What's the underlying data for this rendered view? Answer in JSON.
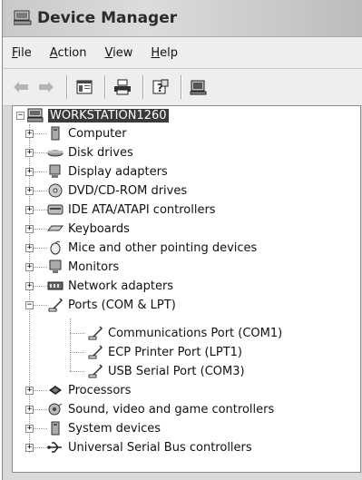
{
  "window": {
    "title": "Device Manager"
  },
  "menu": [
    {
      "label": "File",
      "underline": "F",
      "rest": "ile"
    },
    {
      "label": "Action",
      "underline": "A",
      "rest": "ction"
    },
    {
      "label": "View",
      "underline": "V",
      "rest": "iew"
    },
    {
      "label": "Help",
      "underline": "H",
      "rest": "elp"
    }
  ],
  "toolbar": {
    "buttons": [
      "back-arrow-icon",
      "forward-arrow-icon",
      "properties-pane-icon",
      "print-icon",
      "help-icon",
      "scan-hardware-icon"
    ]
  },
  "tree": {
    "root": {
      "label": "WORKSTATION1260",
      "expanded": true,
      "selected": true
    },
    "categories": [
      {
        "label": "Computer",
        "icon": "computer-icon",
        "expanded": false
      },
      {
        "label": "Disk drives",
        "icon": "disk-drive-icon",
        "expanded": false
      },
      {
        "label": "Display adapters",
        "icon": "display-adapter-icon",
        "expanded": false
      },
      {
        "label": "DVD/CD-ROM drives",
        "icon": "cdrom-icon",
        "expanded": false
      },
      {
        "label": "IDE ATA/ATAPI controllers",
        "icon": "ide-controller-icon",
        "expanded": false
      },
      {
        "label": "Keyboards",
        "icon": "keyboard-icon",
        "expanded": false
      },
      {
        "label": "Mice and other pointing devices",
        "icon": "mouse-icon",
        "expanded": false
      },
      {
        "label": "Monitors",
        "icon": "monitor-icon",
        "expanded": false
      },
      {
        "label": "Network adapters",
        "icon": "network-adapter-icon",
        "expanded": false
      },
      {
        "label": "Ports (COM & LPT)",
        "icon": "port-icon",
        "expanded": true,
        "children": [
          {
            "label": "Communications Port (COM1)",
            "icon": "port-icon"
          },
          {
            "label": "ECP Printer Port (LPT1)",
            "icon": "port-icon"
          },
          {
            "label": "USB Serial Port (COM3)",
            "icon": "port-icon"
          }
        ]
      },
      {
        "label": "Processors",
        "icon": "processor-icon",
        "expanded": false
      },
      {
        "label": "Sound, video and game controllers",
        "icon": "sound-icon",
        "expanded": false
      },
      {
        "label": "System devices",
        "icon": "system-device-icon",
        "expanded": false
      },
      {
        "label": "Universal Serial Bus controllers",
        "icon": "usb-icon",
        "expanded": false
      }
    ]
  }
}
